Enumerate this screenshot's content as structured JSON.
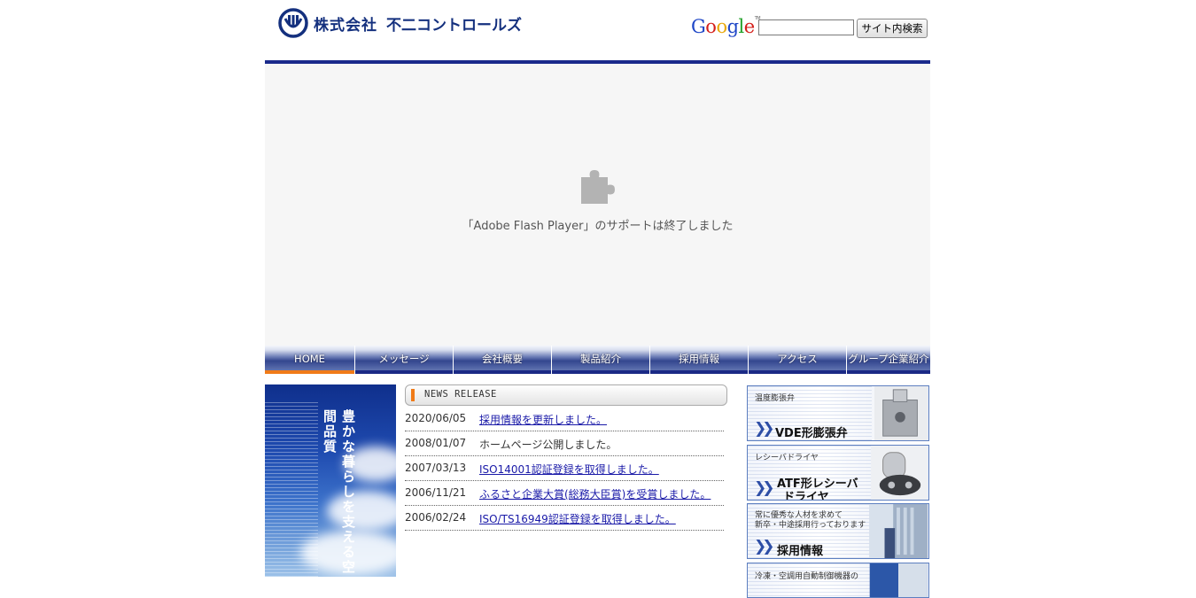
{
  "header": {
    "company_prefix": "株式会社",
    "company_name": "不二コントロールズ",
    "search_provider": "Google",
    "search_button": "サイト内検索",
    "search_value": ""
  },
  "flash": {
    "message": "「Adobe Flash Player」のサポートは終了しました"
  },
  "nav": {
    "items": [
      {
        "label": "HOME"
      },
      {
        "label": "メッセージ"
      },
      {
        "label": "会社概要"
      },
      {
        "label": "製品紹介"
      },
      {
        "label": "採用情報"
      },
      {
        "label": "アクセス"
      },
      {
        "label": "グループ企業紹介"
      }
    ],
    "active": "HOME"
  },
  "banner": {
    "text": "豊かな暮らしを支える空間品質"
  },
  "news": {
    "heading": "NEWS RELEASE",
    "items": [
      {
        "date": "2020/06/05",
        "title": "採用情報を更新しました。",
        "link": true
      },
      {
        "date": "2008/01/07",
        "title": "ホームページ公開しました。",
        "link": false
      },
      {
        "date": "2007/03/13",
        "title": "ISO14001認証登録を取得しました。",
        "link": true
      },
      {
        "date": "2006/11/21",
        "title": "ふるさと企業大賞(総務大臣賞)を受賞しました。",
        "link": true
      },
      {
        "date": "2006/02/24",
        "title": "ISO/TS16949認証登録を取得しました。",
        "link": true
      }
    ]
  },
  "sidebar": {
    "boxes": [
      {
        "small": "温度膨張弁",
        "big": "VDE形膨張弁"
      },
      {
        "small": "レシーバドライヤ",
        "big_line1": "ATF形レシーバ",
        "big_line2": "ドライヤ"
      },
      {
        "small_line1": "常に優秀な人材を求めて",
        "small_line2": "新卒・中途採用行っております",
        "big": "採用情報"
      },
      {
        "small": "冷凍・空調用自動制御機器の"
      }
    ]
  },
  "colors": {
    "brand_blue": "#14307e",
    "header_line": "#1a2a8c",
    "nav_active": "#f07b18",
    "link": "#1a1aa8"
  }
}
